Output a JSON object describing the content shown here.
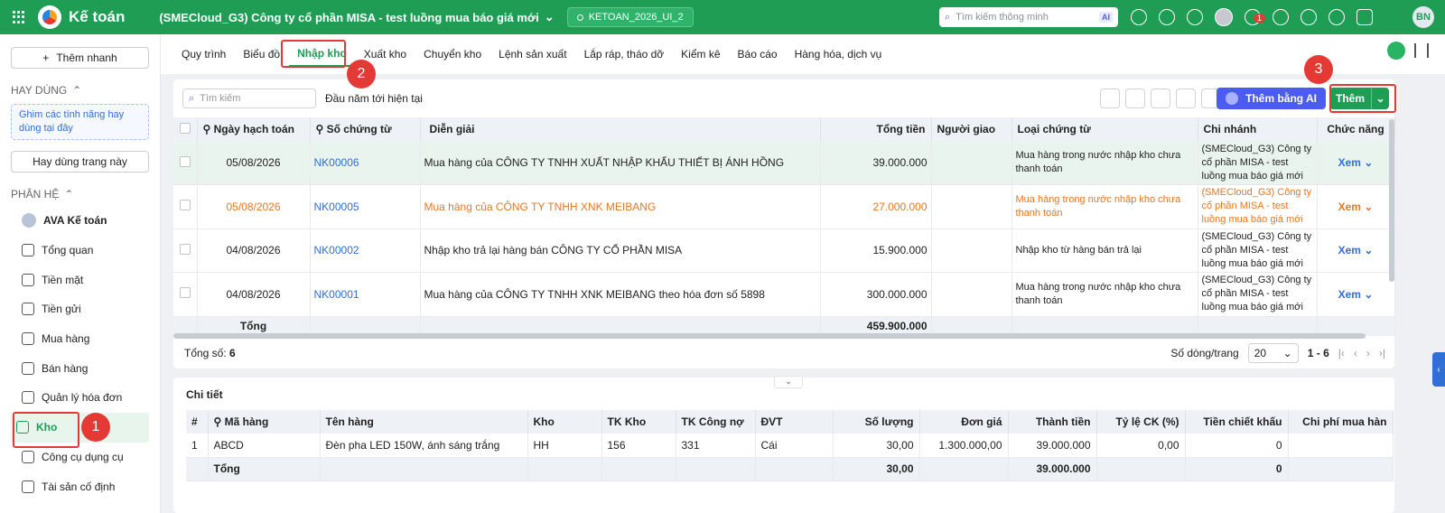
{
  "app": {
    "name": "Kế toán",
    "company": "(SMECloud_G3) Công ty cổ phần MISA - test luồng mua báo giá mới",
    "database": "KETOAN_2026_UI_2",
    "search_placeholder": "Tìm kiếm thông minh",
    "search_ai": "AI",
    "notification_count": "1",
    "user_initials": "BN",
    "accent": "#1f9d55"
  },
  "sidebar": {
    "quick_add": "Thêm nhanh",
    "frequent_title": "HAY DÙNG",
    "pin_hint": "Ghim các tính năng hay dùng tại đây",
    "frequent_button": "Hay dùng trang này",
    "modules_title": "PHÂN HỆ",
    "items": [
      {
        "label": "AVA Kế toán",
        "icon": "ava-avatar-icon"
      },
      {
        "label": "Tổng quan",
        "icon": "dashboard-icon"
      },
      {
        "label": "Tiền mặt",
        "icon": "cash-icon"
      },
      {
        "label": "Tiền gửi",
        "icon": "bank-icon"
      },
      {
        "label": "Mua hàng",
        "icon": "shopping-bag-icon"
      },
      {
        "label": "Bán hàng",
        "icon": "cart-icon"
      },
      {
        "label": "Quản lý hóa đơn",
        "icon": "invoice-icon"
      },
      {
        "label": "Kho",
        "icon": "warehouse-icon"
      },
      {
        "label": "Công cụ dụng cụ",
        "icon": "tools-icon"
      },
      {
        "label": "Tài sản cố định",
        "icon": "truck-icon"
      }
    ]
  },
  "tabs": [
    "Quy trình",
    "Biểu đồ",
    "Nhập kho",
    "Xuất kho",
    "Chuyển kho",
    "Lệnh sản xuất",
    "Lắp ráp, tháo dỡ",
    "Kiểm kê",
    "Báo cáo",
    "Hàng hóa, dịch vụ"
  ],
  "toolbar": {
    "search_placeholder": "Tìm kiếm",
    "period": "Đầu năm tới hiện tại",
    "ai_button": "Thêm bằng AI",
    "add_button": "Thêm"
  },
  "main_table": {
    "headers": [
      "Ngày hạch toán",
      "Số chứng từ",
      "Diễn giải",
      "Tổng tiền",
      "Người giao",
      "Loại chứng từ",
      "Chi nhánh",
      "Chức năng"
    ],
    "rows": [
      {
        "date": "05/08/2026",
        "number": "NK00006",
        "desc": "Mua hàng của CÔNG TY TNHH XUẤT NHẬP KHẨU THIẾT BỊ ÁNH HỒNG",
        "total": "39.000.000",
        "deliverer": "",
        "type": "Mua hàng trong nước nhập kho chưa thanh toán",
        "branch": "(SMECloud_G3) Công ty cổ phần MISA - test luồng mua báo giá mới",
        "action": "Xem"
      },
      {
        "date": "05/08/2026",
        "number": "NK00005",
        "desc": "Mua hàng của CÔNG TY TNHH XNK MEIBANG",
        "total": "27.000.000",
        "deliverer": "",
        "type": "Mua hàng trong nước nhập kho chưa thanh toán",
        "branch": "(SMECloud_G3) Công ty cổ phần MISA - test luồng mua báo giá mới",
        "action": "Xem"
      },
      {
        "date": "04/08/2026",
        "number": "NK00002",
        "desc": "Nhập kho trả lại hàng bán CÔNG TY CỔ PHẦN MISA",
        "total": "15.900.000",
        "deliverer": "",
        "type": "Nhập kho từ hàng bán trả lại",
        "branch": "(SMECloud_G3) Công ty cổ phần MISA - test luồng mua báo giá mới",
        "action": "Xem"
      },
      {
        "date": "04/08/2026",
        "number": "NK00001",
        "desc": "Mua hàng của CÔNG TY TNHH XNK MEIBANG theo hóa đơn số 5898",
        "total": "300.000.000",
        "deliverer": "",
        "type": "Mua hàng trong nước nhập kho chưa thanh toán",
        "branch": "(SMECloud_G3) Công ty cổ phần MISA - test luồng mua báo giá mới",
        "action": "Xem"
      }
    ],
    "total_label": "Tổng",
    "total_value": "459.900.000"
  },
  "footer": {
    "count_label": "Tổng số:",
    "count": "6",
    "rows_per_page_label": "Số dòng/trang",
    "rows_per_page": "20",
    "range": "1 - 6"
  },
  "detail": {
    "title": "Chi tiết",
    "headers": [
      "#",
      "Mã hàng",
      "Tên hàng",
      "Kho",
      "TK Kho",
      "TK Công nợ",
      "ĐVT",
      "Số lượng",
      "Đơn giá",
      "Thành tiền",
      "Tỷ lệ CK (%)",
      "Tiền chiết khấu",
      "Chi phí mua hàn"
    ],
    "rows": [
      {
        "no": "1",
        "code": "ABCD",
        "name": "Đèn pha LED 150W, ánh sáng trắng",
        "warehouse": "HH",
        "acc_stock": "156",
        "acc_debt": "331",
        "unit": "Cái",
        "qty": "30,00",
        "price": "1.300.000,00",
        "amount": "39.000.000",
        "disc_rate": "0,00",
        "disc_amount": "0",
        "cost": ""
      }
    ],
    "total_label": "Tổng",
    "total_qty": "30,00",
    "total_amount": "39.000.000",
    "total_disc": "0"
  },
  "steps": [
    "1",
    "2",
    "3"
  ]
}
